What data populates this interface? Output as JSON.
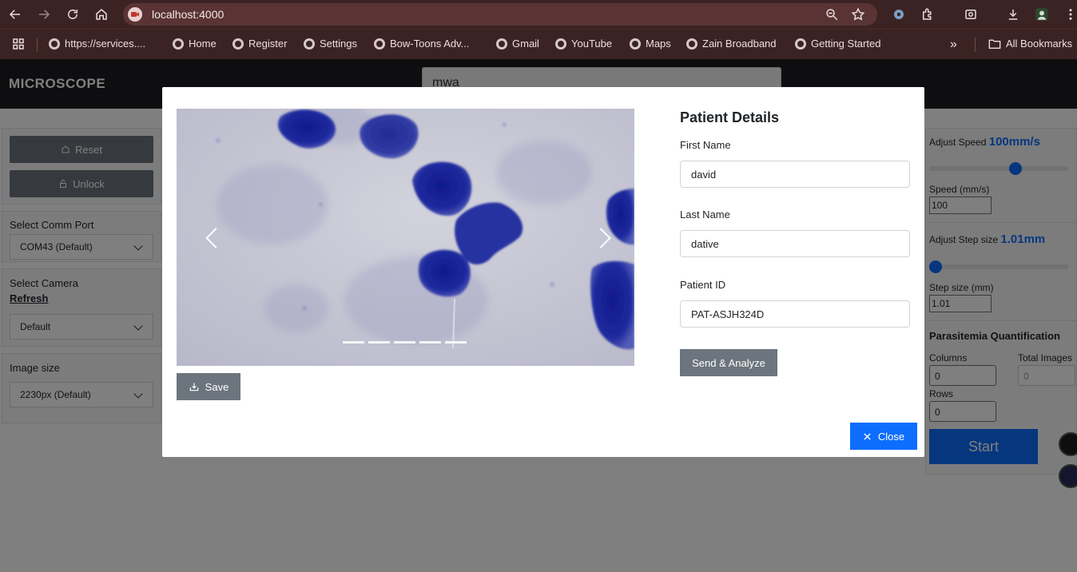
{
  "browser": {
    "url": "localhost:4000",
    "bookmarks": [
      {
        "label": "https://services...."
      },
      {
        "label": "Home"
      },
      {
        "label": "Register"
      },
      {
        "label": "Settings"
      },
      {
        "label": "Bow-Toons Adv..."
      },
      {
        "label": "Gmail"
      },
      {
        "label": "YouTube"
      },
      {
        "label": "Maps"
      },
      {
        "label": "Zain Broadband"
      },
      {
        "label": "Getting Started"
      }
    ],
    "all_bookmarks_label": "All Bookmarks",
    "more_label": "»"
  },
  "app": {
    "brand": "MICROSCOPE",
    "search_value": "mwa",
    "left": {
      "reset_label": "Reset",
      "unlock_label": "Unlock",
      "comm_port_label": "Select Comm Port",
      "comm_port_value": "COM43 (Default)",
      "camera_label": "Select Camera",
      "refresh_label": "Refresh",
      "camera_value": "Default",
      "image_size_label": "Image size",
      "image_size_value": "2230px (Default)"
    },
    "right": {
      "adjust_speed_label": "Adjust Speed",
      "adjust_speed_value": "100mm/s",
      "speed_slider_fraction": 0.63,
      "speed_label": "Speed (mm/s)",
      "speed_value": "100",
      "adjust_step_label": "Adjust Step size",
      "adjust_step_value": "1.01mm",
      "step_slider_fraction": 0.0,
      "step_label": "Step size (mm)",
      "step_value": "1.01",
      "parasitemia_label": "Parasitemia Quantification",
      "columns_label": "Columns",
      "columns_value": "0",
      "total_images_label": "Total Images",
      "total_images_value": "0",
      "rows_label": "Rows",
      "rows_value": "0",
      "start_label": "Start"
    }
  },
  "modal": {
    "save_label": "Save",
    "carousel_slide_count": 5,
    "details_title": "Patient Details",
    "first_name_label": "First Name",
    "first_name_value": "david",
    "last_name_label": "Last Name",
    "last_name_value": "dative",
    "patient_id_label": "Patient ID",
    "patient_id_value": "PAT-ASJH324D",
    "send_label": "Send & Analyze",
    "close_label": "Close"
  },
  "colors": {
    "accent": "#0d6efd",
    "secondary": "#6c757d",
    "chrome": "#3c2323",
    "header": "#1d1d22",
    "stain": "#1f2a8e"
  }
}
